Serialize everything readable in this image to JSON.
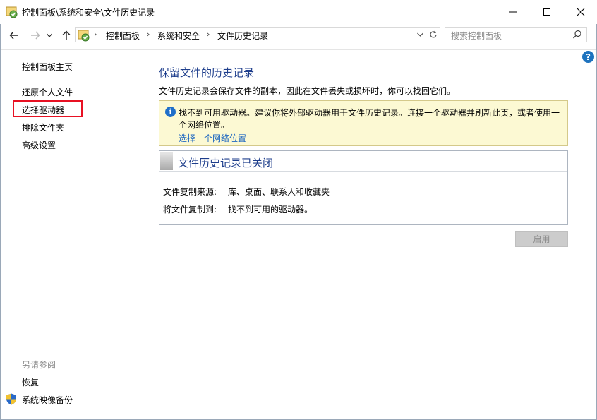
{
  "window": {
    "title": "控制面板\\系统和安全\\文件历史记录"
  },
  "address": {
    "crumbs": [
      "控制面板",
      "系统和安全",
      "文件历史记录"
    ]
  },
  "search": {
    "placeholder": "搜索控制面板"
  },
  "sidebar": {
    "home": "控制面板主页",
    "items": [
      "还原个人文件",
      "选择驱动器",
      "排除文件夹",
      "高级设置"
    ],
    "see_also_title": "另请参阅",
    "see_also_items": [
      "恢复",
      "系统映像备份"
    ]
  },
  "main": {
    "title": "保留文件的历史记录",
    "description": "文件历史记录会保存文件的副本，因此在文件丢失或损坏时，你可以找回它们。",
    "warning": {
      "line1": "找不到可用驱动器。建议你将外部驱动器用于文件历史记录。连接一个驱动器并刷新此页，或者使用一",
      "line2": "个网络位置。",
      "link": "选择一个网络位置"
    },
    "status": {
      "title": "文件历史记录已关闭",
      "copy_from_label": "文件复制来源:",
      "copy_from_value": "库、桌面、联系人和收藏夹",
      "copy_to_label": "将文件复制到:",
      "copy_to_value": "找不到可用的驱动器。"
    },
    "enable_button": "启用"
  },
  "colors": {
    "heading": "#1e3e8c",
    "link": "#1f68c1",
    "warning_bg": "#fcf9d3",
    "highlight": "#e81123",
    "help": "#1e73be"
  },
  "icons": [
    "control-panel-icon",
    "minimize-icon",
    "maximize-icon",
    "close-icon",
    "back-arrow-icon",
    "forward-arrow-icon",
    "chevron-down-icon",
    "up-arrow-icon",
    "refresh-icon",
    "search-icon",
    "help-icon",
    "info-icon",
    "shield-icon"
  ]
}
